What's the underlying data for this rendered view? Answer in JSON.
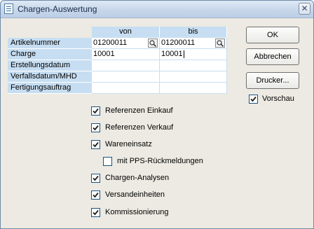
{
  "window": {
    "title": "Chargen-Auswertung",
    "close_glyph": "✕"
  },
  "grid": {
    "col_from": "von",
    "col_to": "bis",
    "rows": [
      {
        "label": "Artikelnummer",
        "from": "01200011",
        "to": "01200011",
        "lookup": true
      },
      {
        "label": "Charge",
        "from": "10001",
        "to": "10001",
        "lookup": false
      },
      {
        "label": "Erstellungsdatum",
        "from": "",
        "to": "",
        "lookup": false
      },
      {
        "label": "Verfallsdatum/MHD",
        "from": "",
        "to": "",
        "lookup": false
      },
      {
        "label": "Fertigungsauftrag",
        "from": "",
        "to": "",
        "lookup": false
      }
    ]
  },
  "buttons": {
    "ok": "OK",
    "cancel": "Abbrechen",
    "printer": "Drucker..."
  },
  "preview": {
    "label": "Vorschau",
    "checked": true
  },
  "options": [
    {
      "key": "einkauf",
      "label": "Referenzen Einkauf",
      "checked": true
    },
    {
      "key": "verkauf",
      "label": "Referenzen Verkauf",
      "checked": true
    },
    {
      "key": "wareneinsatz",
      "label": "Wareneinsatz",
      "checked": true
    },
    {
      "key": "pps",
      "label": "mit PPS-Rückmeldungen",
      "checked": false
    },
    {
      "key": "analysen",
      "label": "Chargen-Analysen",
      "checked": true
    },
    {
      "key": "versand",
      "label": "Versandeinheiten",
      "checked": true
    },
    {
      "key": "kommission",
      "label": "Kommissionierung",
      "checked": true
    }
  ],
  "colors": {
    "grid_header": "#c7def2",
    "title_text": "#1a2c45"
  },
  "icons": {
    "lookup": "magnifier-icon",
    "check": "checkmark-icon"
  }
}
